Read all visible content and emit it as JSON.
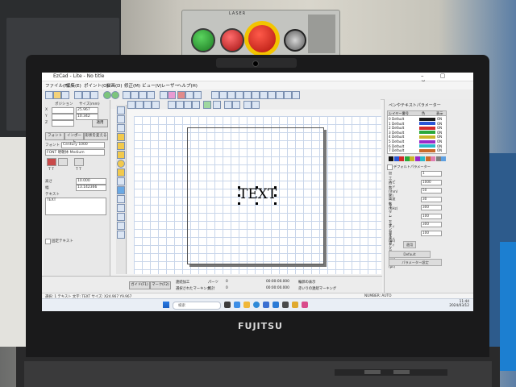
{
  "machine_panel": {
    "label": "LASER",
    "buttons": [
      "start-button",
      "stop-button",
      "emergency-stop",
      "key-switch"
    ]
  },
  "laptop": {
    "brand": "FUJITSU"
  },
  "app": {
    "title": "EzCad - Lite - No title",
    "window_controls": "– ▢ ✕",
    "menu": [
      "ファイル(F)",
      "編集(E)",
      "ポイント(O)",
      "描画(D)",
      "修正(M)",
      "ビュー(V)",
      "レーザー",
      "ヘルプ(H)"
    ]
  },
  "left_panel": {
    "position_label": "ポジション",
    "size_label": "サイズ(mm)",
    "x_value": "25.967",
    "y_value": "10.342",
    "z_label": "Z",
    "apply_button": "適用",
    "tab1": "フォント",
    "tab2": "インポート",
    "tab3": "形状を変える",
    "font_label": "フォント",
    "font_value": "Century 1000",
    "style_value": "FONT 明朝体 Medium",
    "height_label": "高さ",
    "height_value": "10.000",
    "width_label": "幅",
    "width_value": "13.142366",
    "text_label": "テキスト",
    "text_value": "TEXT",
    "fixed_text_label": "固定テキスト"
  },
  "canvas": {
    "object_text": "TEXT"
  },
  "right_panel": {
    "title": "ペンやテキストパラメーター",
    "header_layer": "レイヤー番号",
    "header_color": "色",
    "header_on": "表示",
    "layers": [
      {
        "name": "0 Default",
        "color": "#1a1a1a",
        "on": "ON"
      },
      {
        "name": "1 Default",
        "color": "#2a56d6",
        "on": "ON"
      },
      {
        "name": "2 Default",
        "color": "#d22a2a",
        "on": "ON"
      },
      {
        "name": "3 Default",
        "color": "#2aa83a",
        "on": "ON"
      },
      {
        "name": "4 Default",
        "color": "#c9b62a",
        "on": "ON"
      },
      {
        "name": "5 Default",
        "color": "#9a2ac9",
        "on": "ON"
      },
      {
        "name": "6 Default",
        "color": "#2ab9c9",
        "on": "ON"
      },
      {
        "name": "7 Default",
        "color": "#c96a2a",
        "on": "ON"
      }
    ],
    "palette": [
      "#111111",
      "#2a56d6",
      "#d22a2a",
      "#2aa83a",
      "#c9b62a",
      "#9a2ac9",
      "#2ab9c9",
      "#c96a2a",
      "#e07fb0",
      "#7f7f7f",
      "#5fa0e0"
    ],
    "default_param_label": "デフォルトパラメーター",
    "params": [
      {
        "label": "加工回数",
        "value": "1"
      },
      {
        "label": "スピード(mm/秒)",
        "value": "1000"
      },
      {
        "label": "パワー %",
        "value": "50"
      },
      {
        "label": "周波数(KHz)",
        "value": "30"
      },
      {
        "label": "スタートディレイ(μs)",
        "value": "300"
      },
      {
        "label": "レーザーオフディレイ(μs)",
        "value": "100"
      },
      {
        "label": "エンドディレイ(μs)",
        "value": "300"
      },
      {
        "label": "ポリゴンディレイ(μs)",
        "value": "100"
      }
    ],
    "apply_button": "適用",
    "default_button": "Default",
    "advanced_button": "パラメーター設定"
  },
  "bottom": {
    "red_light": "ガイド(F1)",
    "mark": "マーク(F2)",
    "continuous_label": "連続加工",
    "selected_label": "選択されたマーキング",
    "parts_label": "パーツ",
    "parts_value": "0",
    "total_label": "総計",
    "total_value": "0",
    "time1": "00:00:00.000",
    "time2": "00:00:00.000",
    "show_contour": "輪郭の表示",
    "continuous_mark": "赤いりの連続マーキング"
  },
  "status": {
    "left": "選択: 1 テキスト 文字: TEXT  サイズ: X24.967 Y9.967",
    "right": "NUMBER: AUTO"
  },
  "taskbar": {
    "search_placeholder": "検索",
    "time": "11:44",
    "date": "2024/03/12"
  }
}
